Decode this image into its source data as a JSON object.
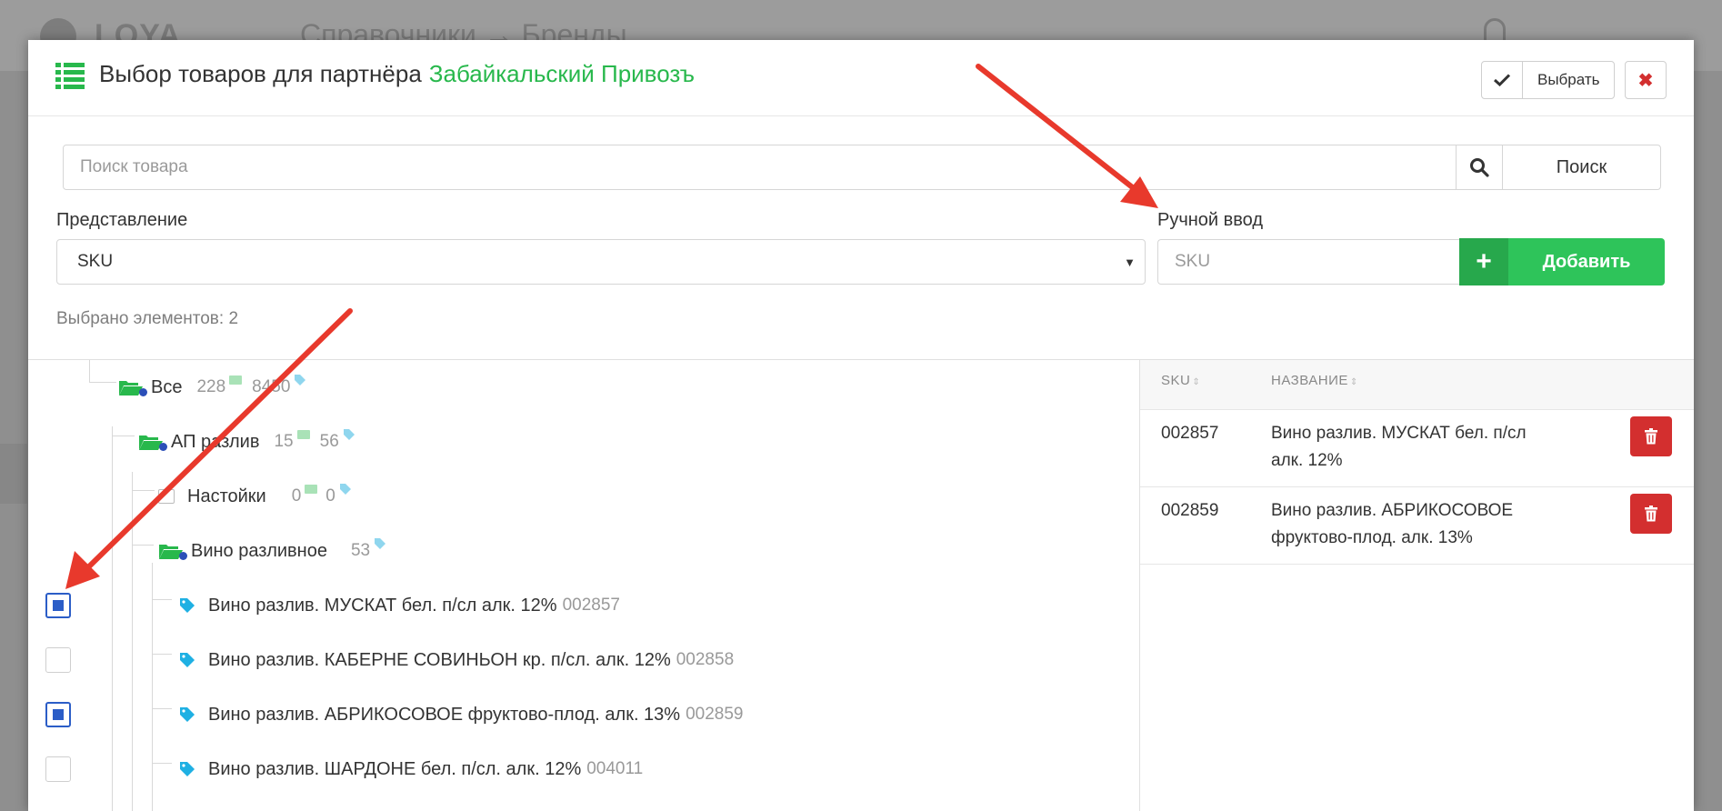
{
  "background": {
    "logo_text": "LOYA",
    "breadcrumb": "Справочники → Бренды"
  },
  "modal": {
    "title": "Выбор товаров для партнёра",
    "partner_name": "Забайкальский Привозъ",
    "select_button": "Выбрать",
    "close_button": "✖"
  },
  "search": {
    "placeholder": "Поиск товара",
    "button": "Поиск"
  },
  "view": {
    "label": "Представление",
    "selected": "SKU"
  },
  "manual": {
    "label": "Ручной ввод",
    "placeholder": "SKU",
    "add_button": "Добавить"
  },
  "selected_count": "Выбрано элементов: 2",
  "tree": {
    "all": {
      "label": "Все",
      "folders": "228",
      "items": "8450"
    },
    "ap": {
      "label": "АП разлив",
      "folders": "15",
      "items": "56"
    },
    "tinctures": {
      "label": "Настойки",
      "folders": "0",
      "items": "0"
    },
    "wine": {
      "label": "Вино разливное",
      "items": "53"
    },
    "products": [
      {
        "name": "Вино разлив. МУСКАТ бел. п/сл алк. 12%",
        "sku": "002857",
        "checked": true
      },
      {
        "name": "Вино разлив. КАБЕРНЕ СОВИНЬОН кр. п/сл. алк. 12%",
        "sku": "002858",
        "checked": false
      },
      {
        "name": "Вино разлив. АБРИКОСОВОЕ фруктово-плод. алк. 13%",
        "sku": "002859",
        "checked": true
      },
      {
        "name": "Вино разлив. ШАРДОНЕ бел. п/сл. алк. 12%",
        "sku": "004011",
        "checked": false
      }
    ]
  },
  "table": {
    "col_sku": "SKU",
    "col_name": "НАЗВАНИЕ",
    "rows": [
      {
        "sku": "002857",
        "name_line1": "Вино разлив. МУСКАТ бел. п/сл",
        "name_line2": "алк. 12%"
      },
      {
        "sku": "002859",
        "name_line1": "Вино разлив. АБРИКОСОВОЕ",
        "name_line2": "фруктово-плод. алк. 13%"
      }
    ]
  },
  "colors": {
    "accent_green": "#28b84c",
    "button_green": "#2ec45a",
    "danger_red": "#d32f2f",
    "checkbox_blue": "#2b5dc7",
    "annotation_arrow": "#e8392c"
  }
}
